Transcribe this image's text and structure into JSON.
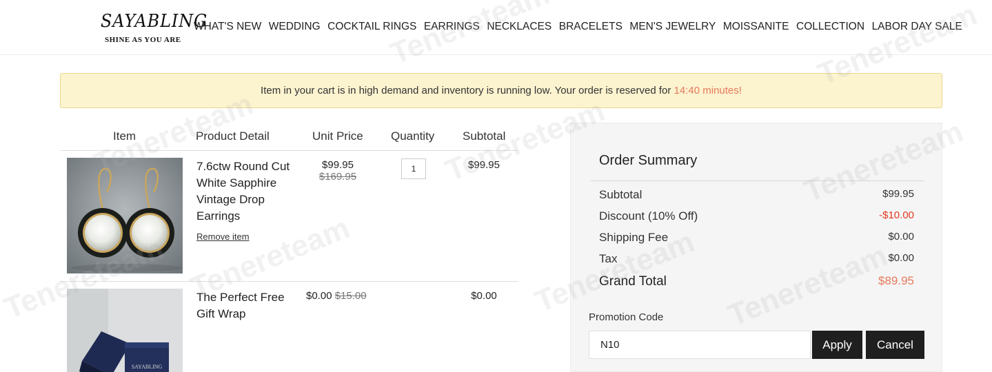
{
  "header": {
    "logo_main": "SAYABLING",
    "logo_sub": "SHINE AS YOU ARE",
    "nav": [
      "WHAT'S NEW",
      "WEDDING",
      "COCKTAIL RINGS",
      "EARRINGS",
      "NECKLACES",
      "BRACELETS",
      "MEN'S JEWELRY",
      "MOISSANITE",
      "COLLECTION",
      "LABOR DAY SALE"
    ]
  },
  "notice": {
    "text": "Item in your cart is in high demand and inventory is running low. Your order is reserved for ",
    "timer": "14:40 minutes!"
  },
  "cart": {
    "headers": {
      "item": "Item",
      "detail": "Product Detail",
      "unit_price": "Unit Price",
      "quantity": "Quantity",
      "subtotal": "Subtotal"
    },
    "items": [
      {
        "name": "7.6ctw Round Cut White Sapphire Vintage Drop Earrings",
        "price": "$99.95",
        "old_price": "$169.95",
        "qty": "1",
        "subtotal": "$99.95",
        "remove": "Remove item"
      },
      {
        "name": "The Perfect Free Gift Wrap",
        "price": "$0.00",
        "old_price": "$15.00",
        "subtotal": "$0.00",
        "box_text": "SAYABLING"
      }
    ]
  },
  "summary": {
    "title": "Order Summary",
    "subtotal_label": "Subtotal",
    "subtotal": "$99.95",
    "discount_label": "Discount (10% Off)",
    "discount": "-$10.00",
    "shipping_label": "Shipping Fee",
    "shipping": "$0.00",
    "tax_label": "Tax",
    "tax": "$0.00",
    "grand_label": "Grand Total",
    "grand": "$89.95",
    "promo_label": "Promotion Code",
    "promo_value": "N10",
    "apply": "Apply",
    "cancel": "Cancel"
  },
  "watermark": "Tenereteam",
  "colors": {
    "notice_bg": "#fcf3cf",
    "timer": "#e57a5c",
    "discount": "#e0381d",
    "button": "#1f1f1f"
  }
}
